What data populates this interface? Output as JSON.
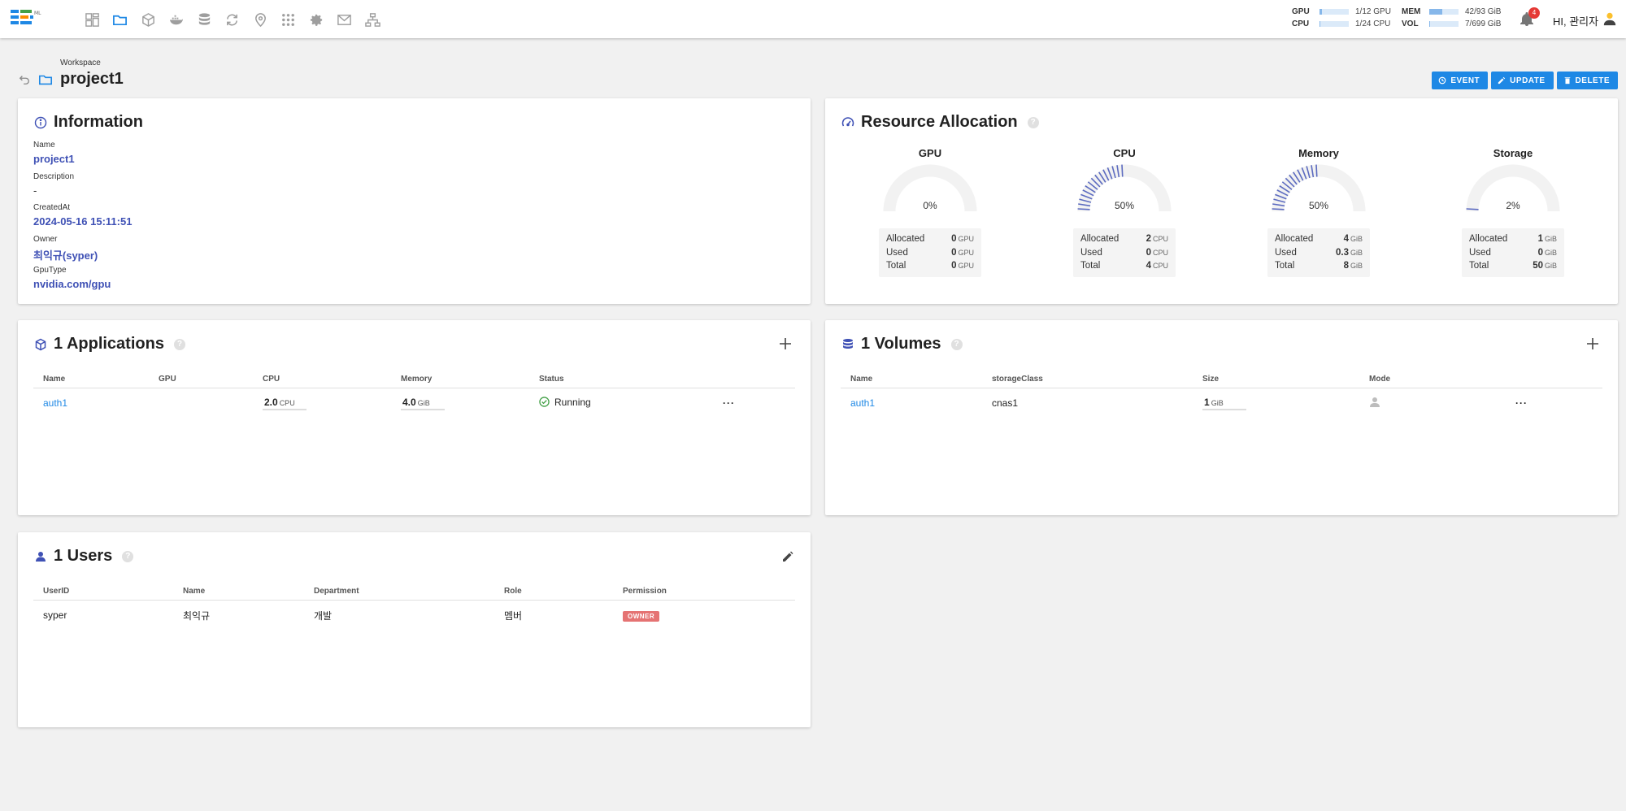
{
  "topbar": {
    "logo_sub": "ML",
    "nav_icons": [
      "dashboard-icon",
      "folder-icon",
      "cube-icon",
      "docker-icon",
      "database-icon",
      "sync-icon",
      "location-icon",
      "apps-icon",
      "gear-icon",
      "mail-icon",
      "sitemap-icon"
    ],
    "usage": [
      {
        "label": "GPU",
        "value": "1/12 GPU",
        "fraction": 0.08
      },
      {
        "label": "CPU",
        "value": "1/24 CPU",
        "fraction": 0.04
      },
      {
        "label": "MEM",
        "value": "42/93 GiB",
        "fraction": 0.45
      },
      {
        "label": "VOL",
        "value": "7/699 GiB",
        "fraction": 0.01
      }
    ],
    "notifications": "4",
    "greeting": "HI, 관리자"
  },
  "header": {
    "breadcrumb": "Workspace",
    "title": "project1",
    "buttons": {
      "event": "EVENT",
      "update": "UPDATE",
      "delete": "DELETE"
    }
  },
  "information": {
    "title": "Information",
    "fields": [
      {
        "label": "Name",
        "value": "project1"
      },
      {
        "label": "Description",
        "value": "-"
      },
      {
        "label": "CreatedAt",
        "value": "2024-05-16 15:11:51"
      },
      {
        "label": "Owner",
        "value": "최익규(syper)"
      },
      {
        "label": "GpuType",
        "value": "nvidia.com/gpu"
      }
    ]
  },
  "resources": {
    "title": "Resource Allocation",
    "row_labels": {
      "allocated": "Allocated",
      "used": "Used",
      "total": "Total"
    },
    "items": [
      {
        "name": "GPU",
        "percent_label": "0%",
        "percent": 0,
        "allocated": "0",
        "used": "0",
        "total": "0",
        "unit": "GPU"
      },
      {
        "name": "CPU",
        "percent_label": "50%",
        "percent": 50,
        "allocated": "2",
        "used": "0",
        "total": "4",
        "unit": "CPU"
      },
      {
        "name": "Memory",
        "percent_label": "50%",
        "percent": 50,
        "allocated": "4",
        "used": "0.3",
        "total": "8",
        "unit": "GiB"
      },
      {
        "name": "Storage",
        "percent_label": "2%",
        "percent": 2,
        "allocated": "1",
        "used": "0",
        "total": "50",
        "unit": "GiB"
      }
    ],
    "colors": {
      "fill": "#5c6bc0",
      "track": "#f2f2f2"
    }
  },
  "applications": {
    "title": "1 Applications",
    "columns": [
      "Name",
      "GPU",
      "CPU",
      "Memory",
      "Status"
    ],
    "rows": [
      {
        "name": "auth1",
        "gpu": "",
        "cpu": "2.0",
        "cpu_unit": "CPU",
        "memory": "4.0",
        "memory_unit": "GiB",
        "status": "Running",
        "more": "···"
      }
    ]
  },
  "volumes": {
    "title": "1 Volumes",
    "columns": [
      "Name",
      "storageClass",
      "Size",
      "Mode"
    ],
    "rows": [
      {
        "name": "auth1",
        "storage_class": "cnas1",
        "size": "1",
        "size_unit": "GiB",
        "mode_icon": "person-icon",
        "more": "···"
      }
    ]
  },
  "users": {
    "title": "1 Users",
    "columns": [
      "UserID",
      "Name",
      "Department",
      "Role",
      "Permission"
    ],
    "rows": [
      {
        "user_id": "syper",
        "name": "최익규",
        "department": "개발",
        "role": "멤버",
        "permission": "OWNER"
      }
    ]
  }
}
